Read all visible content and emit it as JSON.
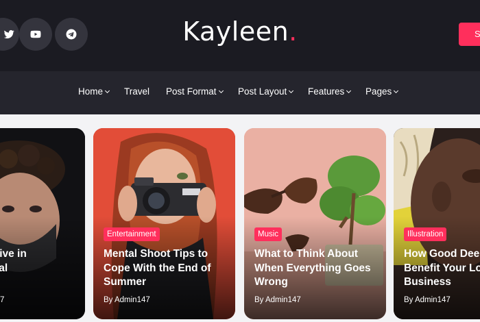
{
  "header": {
    "social_icons": [
      "twitter-icon",
      "youtube-icon",
      "telegram-icon"
    ],
    "logo_text": "Kayleen",
    "logo_dot": ".",
    "cta_label": "S",
    "accent_color": "#ff2f5c",
    "background_color": "#1b1b22"
  },
  "nav": {
    "items": [
      {
        "label": "Home"
      },
      {
        "label": "Travel"
      },
      {
        "label": "Post Format"
      },
      {
        "label": "Post Layout"
      },
      {
        "label": "Features"
      },
      {
        "label": "Pages"
      }
    ]
  },
  "cards": [
    {
      "category": "",
      "title_line1": "akes to Live in",
      "title_line2": "d of Denial",
      "title_line3": "",
      "author": "7"
    },
    {
      "category": "Entertainment",
      "title_line1": "Mental Shoot Tips to",
      "title_line2": "Cope With the End of",
      "title_line3": "Summer",
      "author": "By  Admin147"
    },
    {
      "category": "Music",
      "title_line1": "What to Think About",
      "title_line2": "When Everything Goes",
      "title_line3": "Wrong",
      "author": "By  Admin147"
    },
    {
      "category": "Illustration",
      "title_line1": "How Good Dee",
      "title_line2": "Benefit Your Lo",
      "title_line3": "Business",
      "author": "By  Admin147"
    }
  ]
}
